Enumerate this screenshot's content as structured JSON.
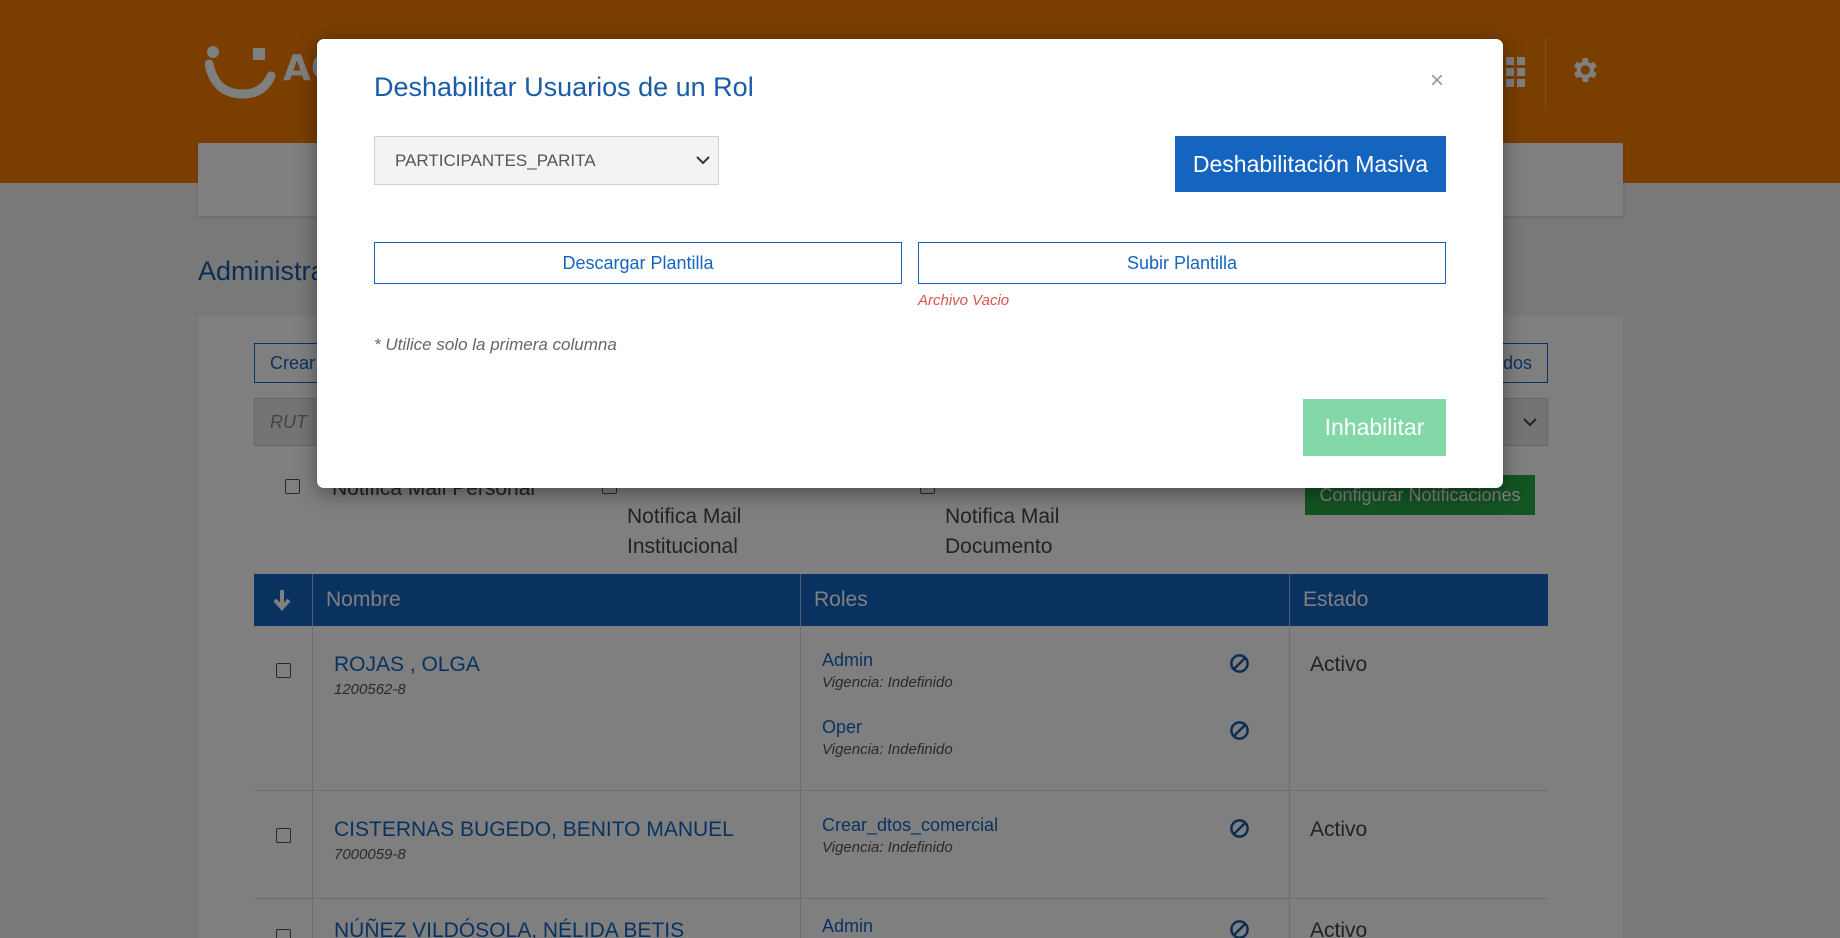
{
  "header": {
    "logo_text": "AC"
  },
  "page": {
    "title": "Administra",
    "crear_label": "Crear",
    "todos_label": "dos",
    "rut_placeholder": "RUT",
    "notif": {
      "personal": "Notifica Mail Personal",
      "institucional": "Notifica Mail Institucional",
      "documento": "Notifica Mail Documento"
    },
    "config_label": "Configurar Notificaciones"
  },
  "table": {
    "headers": {
      "nombre": "Nombre",
      "roles": "Roles",
      "estado": "Estado"
    },
    "rows": [
      {
        "name": "ROJAS , OLGA",
        "rut": "1200562-8",
        "roles": [
          {
            "name": "Admin",
            "vigencia": "Vigencia: Indefinido"
          },
          {
            "name": "Oper",
            "vigencia": "Vigencia: Indefinido"
          }
        ],
        "estado": "Activo"
      },
      {
        "name": "CISTERNAS BUGEDO, BENITO MANUEL",
        "rut": "7000059-8",
        "roles": [
          {
            "name": "Crear_dtos_comercial",
            "vigencia": "Vigencia: Indefinido"
          }
        ],
        "estado": "Activo"
      },
      {
        "name": "NÚÑEZ VILDÓSOLA, NÉLIDA BETIS",
        "rut": "",
        "roles": [
          {
            "name": "Admin",
            "vigencia": ""
          }
        ],
        "estado": "Activo"
      }
    ]
  },
  "modal": {
    "title": "Deshabilitar Usuarios de un Rol",
    "close_symbol": "×",
    "selected_role": "PARTICIPANTES_PARITA",
    "masiva_label": "Deshabilitación Masiva",
    "descargar_label": "Descargar Plantilla",
    "subir_label": "Subir Plantilla",
    "error": "Archivo Vacio",
    "hint": "* Utilice solo la primera columna",
    "inhabilitar_label": "Inhabilitar"
  },
  "colors": {
    "brand_orange": "#f57c00",
    "primary_blue": "#1565c0",
    "success_green": "#28a745",
    "disabled_green": "#82d8a6",
    "error_red": "#d9534f"
  }
}
